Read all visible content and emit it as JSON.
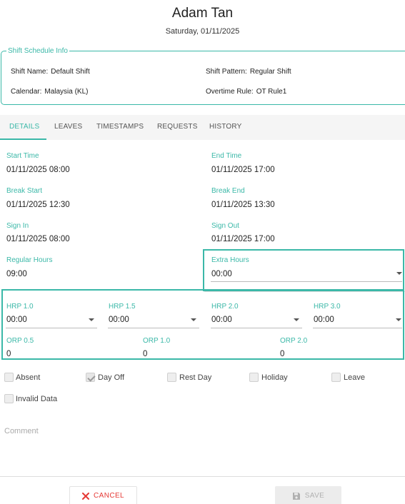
{
  "header": {
    "name": "Adam Tan",
    "date": "Saturday, 01/11/2025"
  },
  "shift_info": {
    "legend": "Shift Schedule Info",
    "shift_name_label": "Shift Name:",
    "shift_name": "Default Shift",
    "shift_pattern_label": "Shift Pattern:",
    "shift_pattern": "Regular Shift",
    "calendar_label": "Calendar:",
    "calendar": "Malaysia (KL)",
    "overtime_rule_label": "Overtime Rule:",
    "overtime_rule": "OT Rule1"
  },
  "tabs": [
    {
      "label": "DETAILS",
      "active": true
    },
    {
      "label": "LEAVES",
      "active": false
    },
    {
      "label": "TIMESTAMPS",
      "active": false
    },
    {
      "label": "REQUESTS",
      "active": false
    },
    {
      "label": "HISTORY",
      "active": false
    }
  ],
  "details": {
    "start_time": {
      "label": "Start Time",
      "value": "01/11/2025 08:00"
    },
    "end_time": {
      "label": "End Time",
      "value": "01/11/2025 17:00"
    },
    "break_start": {
      "label": "Break Start",
      "value": "01/11/2025 12:30"
    },
    "break_end": {
      "label": "Break End",
      "value": "01/11/2025 13:30"
    },
    "sign_in": {
      "label": "Sign In",
      "value": "01/11/2025 08:00"
    },
    "sign_out": {
      "label": "Sign Out",
      "value": "01/11/2025 17:00"
    },
    "regular_hours": {
      "label": "Regular Hours",
      "value": "09:00"
    },
    "extra_hours": {
      "label": "Extra Hours",
      "value": "00:00"
    },
    "hrp_1_0": {
      "label": "HRP 1.0",
      "value": "00:00"
    },
    "hrp_1_5": {
      "label": "HRP 1.5",
      "value": "00:00"
    },
    "hrp_2_0": {
      "label": "HRP 2.0",
      "value": "00:00"
    },
    "hrp_3_0": {
      "label": "HRP 3.0",
      "value": "00:00"
    },
    "orp_0_5": {
      "label": "ORP 0.5",
      "value": "0"
    },
    "orp_1_0": {
      "label": "ORP 1.0",
      "value": "0"
    },
    "orp_2_0": {
      "label": "ORP 2.0",
      "value": "0"
    }
  },
  "checkboxes": {
    "absent": {
      "label": "Absent",
      "checked": false
    },
    "day_off": {
      "label": "Day Off",
      "checked": true
    },
    "rest_day": {
      "label": "Rest Day",
      "checked": false
    },
    "holiday": {
      "label": "Holiday",
      "checked": false
    },
    "leave": {
      "label": "Leave",
      "checked": false
    },
    "invalid_data": {
      "label": "Invalid Data",
      "checked": false
    }
  },
  "comment": {
    "label": "Comment"
  },
  "actions": {
    "cancel_label": "CANCEL",
    "save_label": "SAVE"
  },
  "colors": {
    "accent": "#3bb8a8",
    "cancel": "#e53935",
    "disabled": "#b0b0b0"
  }
}
